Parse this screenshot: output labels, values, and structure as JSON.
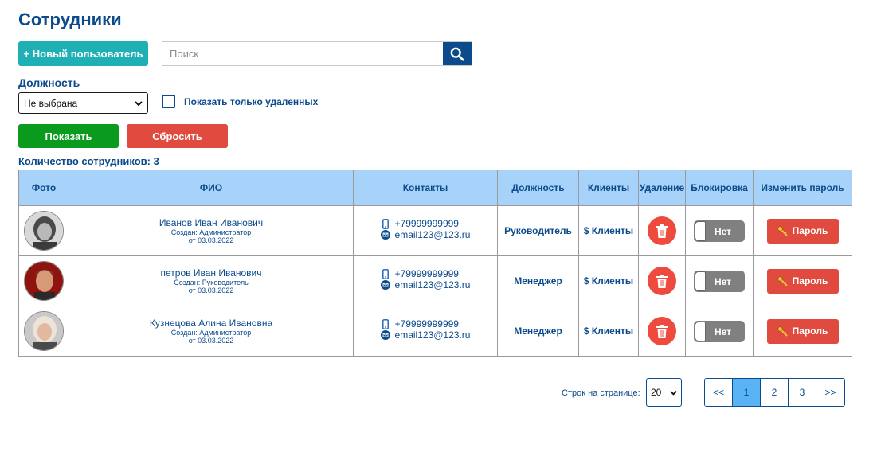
{
  "page": {
    "title": "Сотрудники"
  },
  "toolbar": {
    "new_user_label": "+ Новый пользователь",
    "search_placeholder": "Поиск",
    "search_value": ""
  },
  "filters": {
    "position_label": "Должность",
    "position_selected": "Не выбрана",
    "deleted_only_label": "Показать только удаленных",
    "deleted_only_checked": false,
    "show_label": "Показать",
    "reset_label": "Сбросить"
  },
  "summary": {
    "count_text": "Количество сотрудников: 3"
  },
  "table": {
    "headers": {
      "photo": "Фото",
      "name": "ФИО",
      "contacts": "Контакты",
      "position": "Должность",
      "clients": "Клиенты",
      "delete": "Удаление",
      "block": "Блокировка",
      "password": "Изменить пароль"
    },
    "rows": [
      {
        "name": "Иванов Иван Иванович",
        "created_by": "Создан: Администратор",
        "created_at": "от 03.03.2022",
        "phone": "+79999999999",
        "email": "email123@123.ru",
        "position": "Руководитель",
        "clients": "$ Клиенты",
        "blocked": "Нет",
        "password": "Пароль"
      },
      {
        "name": "петров Иван Иванович",
        "created_by": "Создан: Руководитель",
        "created_at": "от 03.03.2022",
        "phone": "+79999999999",
        "email": "email123@123.ru",
        "position": "Менеджер",
        "clients": "$ Клиенты",
        "blocked": "Нет",
        "password": "Пароль"
      },
      {
        "name": "Кузнецова Алина Ивановна",
        "created_by": "Создан: Администратор",
        "created_at": "от 03.03.2022",
        "phone": "+79999999999",
        "email": "email123@123.ru",
        "position": "Менеджер",
        "clients": "$ Клиенты",
        "blocked": "Нет",
        "password": "Пароль"
      }
    ]
  },
  "pagination": {
    "rows_per_page_label": "Строк на странице:",
    "rows_per_page_value": "20",
    "first": "<<",
    "pages": [
      "1",
      "2",
      "3"
    ],
    "current_page": "1",
    "last": ">>"
  },
  "colors": {
    "primary": "#0b4a8b",
    "teal": "#1fb0b6",
    "green": "#0a9a1e",
    "red": "#e04a3f",
    "header_bg": "#a7d3fb",
    "active_page": "#5ab3f5",
    "toggle_off": "#808080"
  }
}
